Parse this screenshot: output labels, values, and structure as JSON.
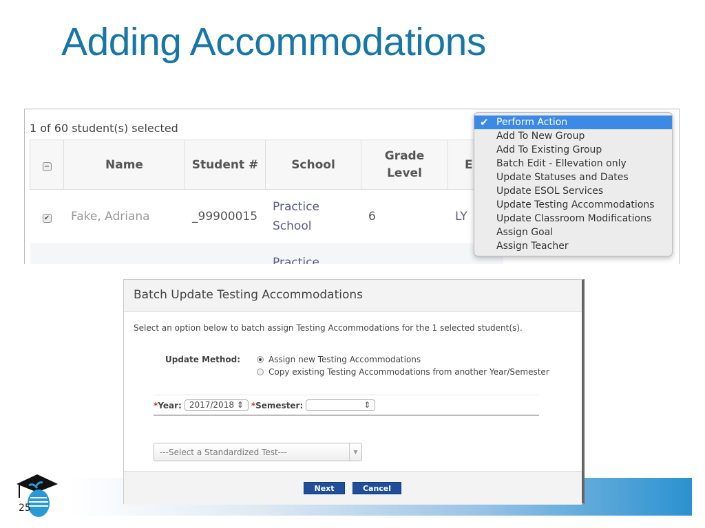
{
  "slide": {
    "title": "Adding Accommodations",
    "page_number": "25",
    "accent": "#1676a6"
  },
  "students": {
    "selected_text": "1 of 60 student(s) selected",
    "columns": [
      "Name",
      "Student #",
      "School",
      "Grade Level",
      "E"
    ],
    "rows": [
      {
        "checked": true,
        "name": "Fake, Adriana",
        "student_no": "_99900015",
        "school": "Practice School",
        "grade": "6",
        "extra": "LY"
      },
      {
        "checked": false,
        "name": "",
        "student_no": "",
        "school": "Practice",
        "grade": "",
        "extra": ""
      }
    ]
  },
  "action_menu": {
    "selected": "Perform Action",
    "items": [
      "Perform Action",
      "Add To New Group",
      "Add To Existing Group",
      "Batch Edit - Ellevation only",
      "Update Statuses and Dates",
      "Update ESOL Services",
      "Update Testing Accommodations",
      "Update Classroom Modifications",
      "Assign Goal",
      "Assign Teacher"
    ]
  },
  "modal": {
    "title": "Batch Update Testing Accommodations",
    "description": "Select an option below to batch assign Testing Accommodations for the 1 selected student(s).",
    "update_method_label": "Update Method:",
    "options": [
      "Assign new Testing Accommodations",
      "Copy existing Testing Accommodations from another Year/Semester"
    ],
    "selected_option": 0,
    "year_label": "Year:",
    "year_value": "2017/2018",
    "semester_label": "Semester:",
    "semester_value": "",
    "required_mark": "*",
    "test_placeholder": "---Select a Standardized Test---",
    "next": "Next",
    "cancel": "Cancel"
  }
}
